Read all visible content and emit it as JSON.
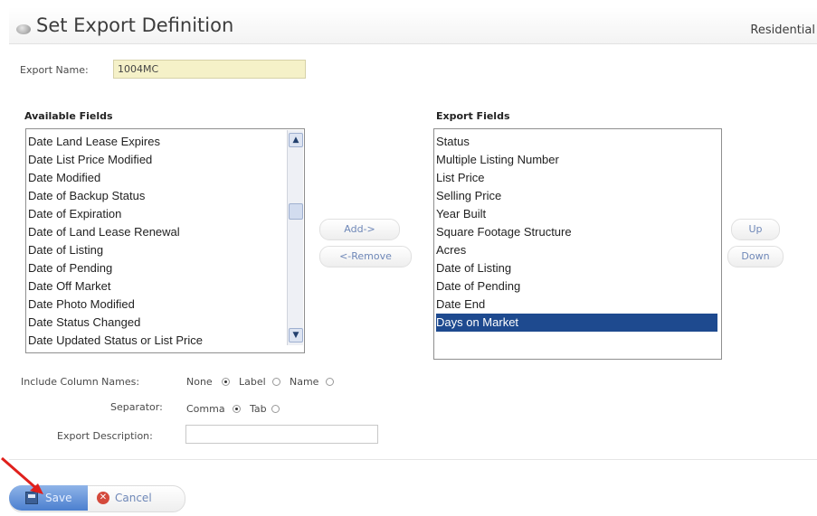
{
  "header": {
    "title": "Set Export Definition",
    "category": "Residential"
  },
  "export_name": {
    "label": "Export Name:",
    "value": "1004MC"
  },
  "available_fields": {
    "heading": "Available Fields",
    "items": [
      "Date Land Lease Expires",
      "Date List Price Modified",
      "Date Modified",
      "Date of Backup Status",
      "Date of Expiration",
      "Date of Land Lease Renewal",
      "Date of Listing",
      "Date of Pending",
      "Date Off Market",
      "Date Photo Modified",
      "Date Status Changed",
      "Date Updated Status or List Price"
    ]
  },
  "export_fields": {
    "heading": "Export Fields",
    "items": [
      "Status",
      "Multiple Listing Number",
      "List Price",
      "Selling Price",
      "Year Built",
      "Square Footage Structure",
      "Acres",
      "Date of Listing",
      "Date of Pending",
      "Date End",
      "Days on Market"
    ],
    "selected": "Days on Market"
  },
  "buttons": {
    "add": "Add->",
    "remove": "<-Remove",
    "up": "Up",
    "down": "Down",
    "save": "Save",
    "cancel": "Cancel"
  },
  "options": {
    "include_label": "Include Column Names:",
    "include_options": [
      "None",
      "Label",
      "Name"
    ],
    "include_selected": "None",
    "separator_label": "Separator:",
    "separator_options": [
      "Comma",
      "Tab"
    ],
    "separator_selected": "Comma",
    "description_label": "Export Description:",
    "description_value": ""
  },
  "colors": {
    "selection": "#1e4a8f",
    "name_field": "#f5f1c8",
    "save_button": "#4b7fcf"
  }
}
